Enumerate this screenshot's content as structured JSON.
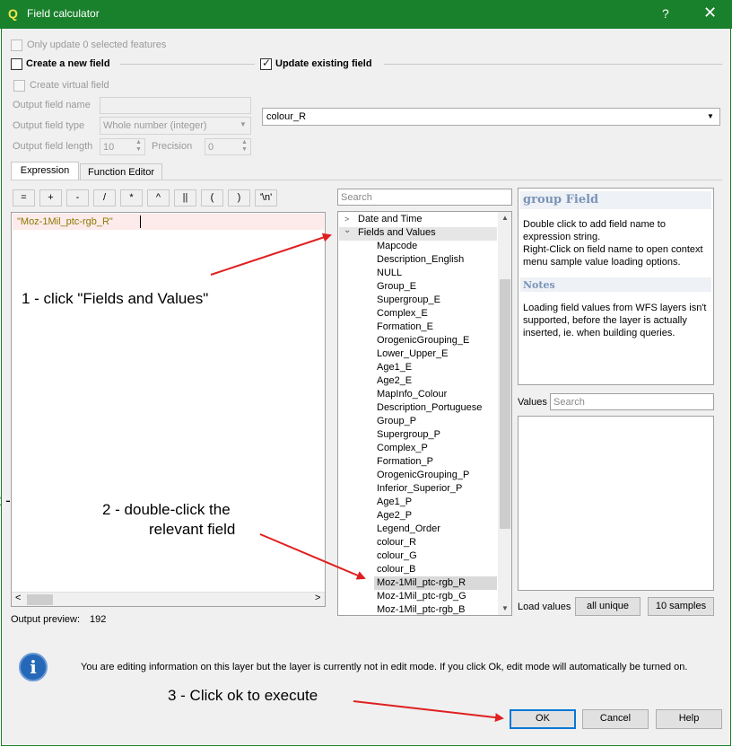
{
  "window": {
    "title": "Field calculator",
    "help_glyph": "?",
    "close_glyph": "✕"
  },
  "top": {
    "only_update": "Only update 0 selected features",
    "create_new_field": "Create a new field",
    "update_existing_field": "Update existing field",
    "create_virtual_field": "Create virtual field",
    "output_field_name_label": "Output field name",
    "output_field_type_label": "Output field type",
    "output_field_type_value": "Whole number (integer)",
    "output_field_length_label": "Output field length",
    "output_field_length_value": "10",
    "precision_label": "Precision",
    "precision_value": "0",
    "existing_field_value": "colour_R"
  },
  "tabs": {
    "expression": "Expression",
    "function_editor": "Function Editor"
  },
  "operators": [
    "=",
    "+",
    "-",
    "/",
    "*",
    "^",
    "||",
    "(",
    ")",
    "'\\n'"
  ],
  "expression": {
    "text": "\"Moz-1Mil_ptc-rgb_R\"",
    "output_preview_label": "Output preview:",
    "output_preview_value": "192"
  },
  "tree": {
    "search_placeholder": "Search",
    "group_date_time": "Date and Time",
    "group_fields": "Fields and Values",
    "fields": [
      "Mapcode",
      "Description_English",
      "NULL",
      "Group_E",
      "Supergroup_E",
      "Complex_E",
      "Formation_E",
      "OrogenicGrouping_E",
      "Lower_Upper_E",
      "Age1_E",
      "Age2_E",
      "MapInfo_Colour",
      "Description_Portuguese",
      "Group_P",
      "Supergroup_P",
      "Complex_P",
      "Formation_P",
      "OrogenicGrouping_P",
      "Inferior_Superior_P",
      "Age1_P",
      "Age2_P",
      "Legend_Order",
      "colour_R",
      "colour_G",
      "colour_B",
      "Moz-1Mil_ptc-rgb_R",
      "Moz-1Mil_ptc-rgb_G",
      "Moz-1Mil_ptc-rgb_B"
    ],
    "selected_field": "Moz-1Mil_ptc-rgb_R"
  },
  "help": {
    "title": "group Field",
    "line1": "Double click to add field name to",
    "line2": "expression string.",
    "line3": "Right-Click on field name to open context",
    "line4": "menu sample value loading options.",
    "notes_title": "Notes",
    "notes1": "Loading field values from WFS layers isn't",
    "notes2": "supported, before the layer is actually",
    "notes3": "inserted, ie. when building queries."
  },
  "values": {
    "label": "Values",
    "search_placeholder": "Search",
    "load_values_label": "Load values",
    "all_unique": "all unique",
    "ten_samples": "10 samples"
  },
  "info": {
    "icon_glyph": "i",
    "message": "You are editing information on this layer but the layer is currently not in edit mode. If you click Ok, edit mode will automatically be turned on."
  },
  "buttons": {
    "ok": "OK",
    "cancel": "Cancel",
    "help": "Help"
  },
  "annotations": {
    "a1": "1 - click \"Fields and Values\"",
    "a2_line1": "2 - double-click the",
    "a2_line2": "relevant field",
    "a3": "3 - Click ok to execute",
    "left_fragment": "2 -"
  },
  "colors": {
    "titlebar": "#19802c",
    "arrow": "#e02020",
    "expression_text": "#8a7a00",
    "ok_border": "#0078d7"
  }
}
